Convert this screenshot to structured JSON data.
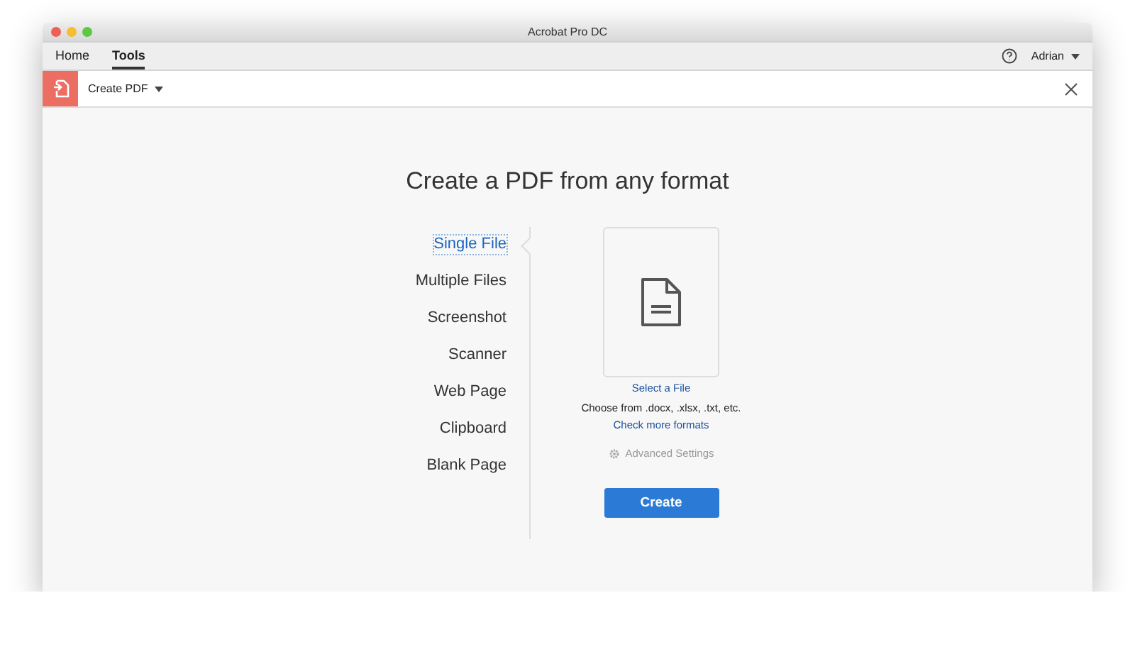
{
  "window": {
    "title": "Acrobat Pro DC"
  },
  "tabs": [
    {
      "label": "Home",
      "selected": false
    },
    {
      "label": "Tools",
      "selected": true
    }
  ],
  "user": {
    "name": "Adrian"
  },
  "toolbar": {
    "tool": "Create PDF"
  },
  "heading": "Create a PDF from any format",
  "sources": [
    {
      "label": "Single File",
      "selected": true
    },
    {
      "label": "Multiple Files",
      "selected": false
    },
    {
      "label": "Screenshot",
      "selected": false
    },
    {
      "label": "Scanner",
      "selected": false
    },
    {
      "label": "Web Page",
      "selected": false
    },
    {
      "label": "Clipboard",
      "selected": false
    },
    {
      "label": "Blank Page",
      "selected": false
    }
  ],
  "panel": {
    "select_link": "Select a File",
    "formats": "Choose from .docx, .xlsx, .txt, etc.",
    "more_link": "Check more formats",
    "advanced": "Advanced Settings",
    "create_button": "Create"
  }
}
